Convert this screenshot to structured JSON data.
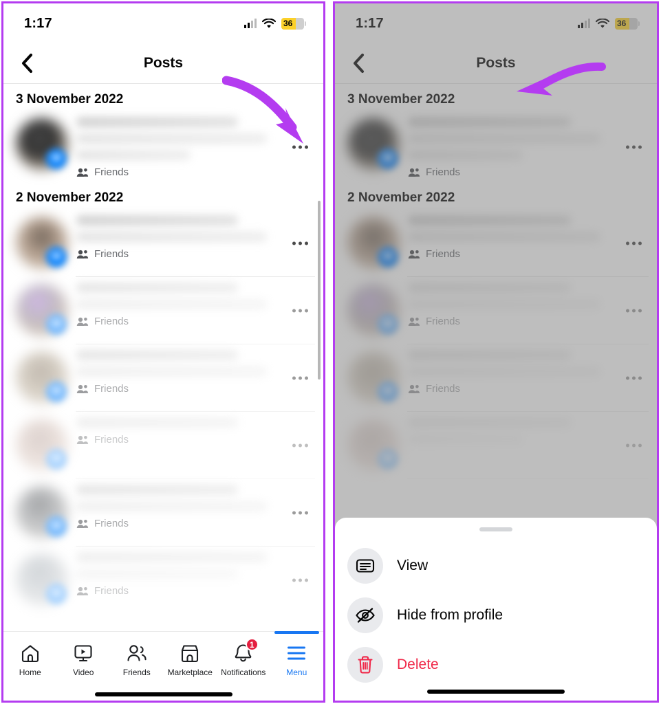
{
  "accent_colors": {
    "annotation_purple": "#b43cf0",
    "facebook_blue": "#1877f2",
    "delete_red": "#f02849",
    "badge_red": "#e41e3f",
    "battery_yellow": "#fcd12a"
  },
  "status_bar": {
    "time": "1:17",
    "battery_percent": "36",
    "signal_icon": "cellular-signal-icon",
    "wifi_icon": "wifi-icon",
    "battery_icon": "battery-low-power-icon"
  },
  "nav": {
    "back_icon": "chevron-left-icon",
    "title": "Posts"
  },
  "feed": {
    "sections": [
      {
        "date": "3 November 2022",
        "posts": [
          {
            "privacy": "Friends",
            "privacy_icon": "friends-icon",
            "menu_icon": "ellipsis-icon"
          }
        ]
      },
      {
        "date": "2 November 2022",
        "posts": [
          {
            "privacy": "Friends",
            "privacy_icon": "friends-icon",
            "menu_icon": "ellipsis-icon"
          },
          {
            "privacy": "Friends",
            "privacy_icon": "friends-icon",
            "menu_icon": "ellipsis-icon"
          },
          {
            "privacy": "Friends",
            "privacy_icon": "friends-icon",
            "menu_icon": "ellipsis-icon"
          },
          {
            "privacy": "Friends",
            "privacy_icon": "friends-icon",
            "menu_icon": "ellipsis-icon"
          },
          {
            "privacy": "Friends",
            "privacy_icon": "friends-icon",
            "menu_icon": "ellipsis-icon"
          },
          {
            "privacy": "Friends",
            "privacy_icon": "friends-icon",
            "menu_icon": "ellipsis-icon"
          }
        ]
      }
    ]
  },
  "tabbar": {
    "items": [
      {
        "label": "Home",
        "icon": "home-icon",
        "active": false,
        "badge": ""
      },
      {
        "label": "Video",
        "icon": "video-icon",
        "active": false,
        "badge": ""
      },
      {
        "label": "Friends",
        "icon": "friends-icon",
        "active": false,
        "badge": ""
      },
      {
        "label": "Marketplace",
        "icon": "marketplace-icon",
        "active": false,
        "badge": ""
      },
      {
        "label": "Notifications",
        "icon": "bell-icon",
        "active": false,
        "badge": "1"
      },
      {
        "label": "Menu",
        "icon": "hamburger-menu-icon",
        "active": true,
        "badge": ""
      }
    ]
  },
  "action_sheet": {
    "handle": "sheet-drag-handle",
    "items": [
      {
        "label": "View",
        "icon": "article-card-icon",
        "danger": false
      },
      {
        "label": "Hide from profile",
        "icon": "eye-slash-icon",
        "danger": false
      },
      {
        "label": "Delete",
        "icon": "trash-icon",
        "danger": true
      }
    ]
  },
  "annotations": [
    {
      "name": "arrow-to-post-menu",
      "shape": "curved-arrow-down-right",
      "color": "#b43cf0"
    },
    {
      "name": "arrow-to-hide-option",
      "shape": "curved-arrow-left",
      "color": "#b43cf0"
    }
  ]
}
